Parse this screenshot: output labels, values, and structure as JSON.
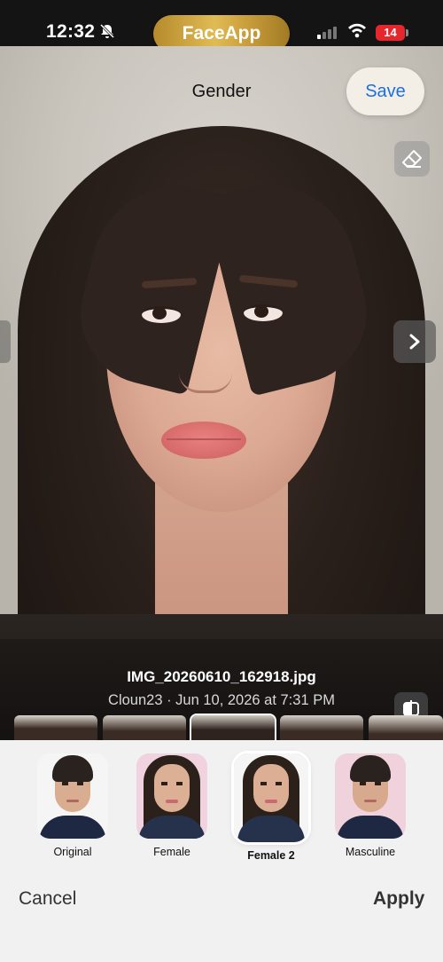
{
  "status_bar": {
    "time": "12:32",
    "battery": "14",
    "app_pill": "FaceApp"
  },
  "header": {
    "title": "Gender",
    "save_label": "Save"
  },
  "photo_info": {
    "filename": "IMG_20260610_162918.jpg",
    "meta": "Cloun23 · Jun 10, 2026 at 7:31 PM"
  },
  "options": [
    {
      "label": "Original",
      "selected": false
    },
    {
      "label": "Female",
      "selected": false
    },
    {
      "label": "Female 2",
      "selected": true
    },
    {
      "label": "Masculine",
      "selected": false
    }
  ],
  "actions": {
    "cancel": "Cancel",
    "apply": "Apply"
  },
  "colors": {
    "accent": "#1d6fe0",
    "battery_low": "#e5262d",
    "pill_gold": "#d4ad4a"
  }
}
